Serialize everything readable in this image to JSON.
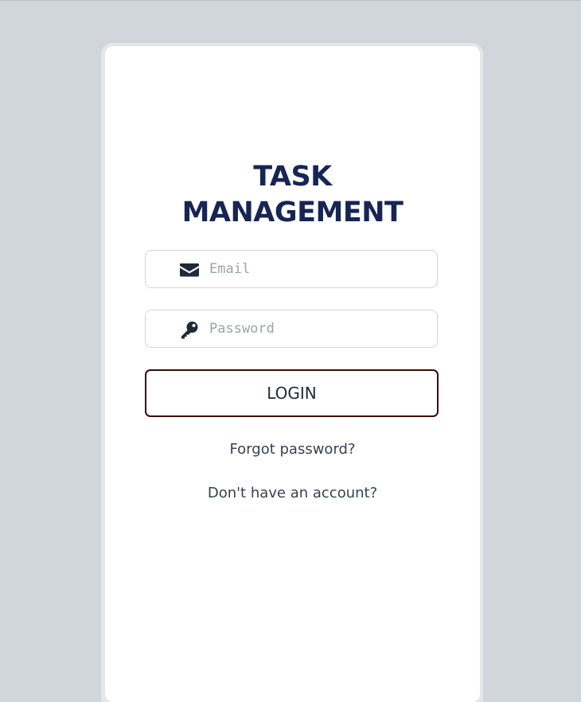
{
  "app": {
    "title_line1": "TASK",
    "title_line2": "MANAGEMENT"
  },
  "form": {
    "email": {
      "placeholder": "Email",
      "value": "",
      "icon": "envelope-icon"
    },
    "password": {
      "placeholder": "Password",
      "value": "",
      "icon": "key-icon"
    },
    "login_label": "LOGIN"
  },
  "links": {
    "forgot_password": "Forgot password?",
    "signup_prompt": "Don't have an account?"
  },
  "colors": {
    "background": "#d1d5dc",
    "card": "#ffffff",
    "title": "#172554",
    "login_border": "#3b0a0a",
    "icon": "#1f2937"
  }
}
